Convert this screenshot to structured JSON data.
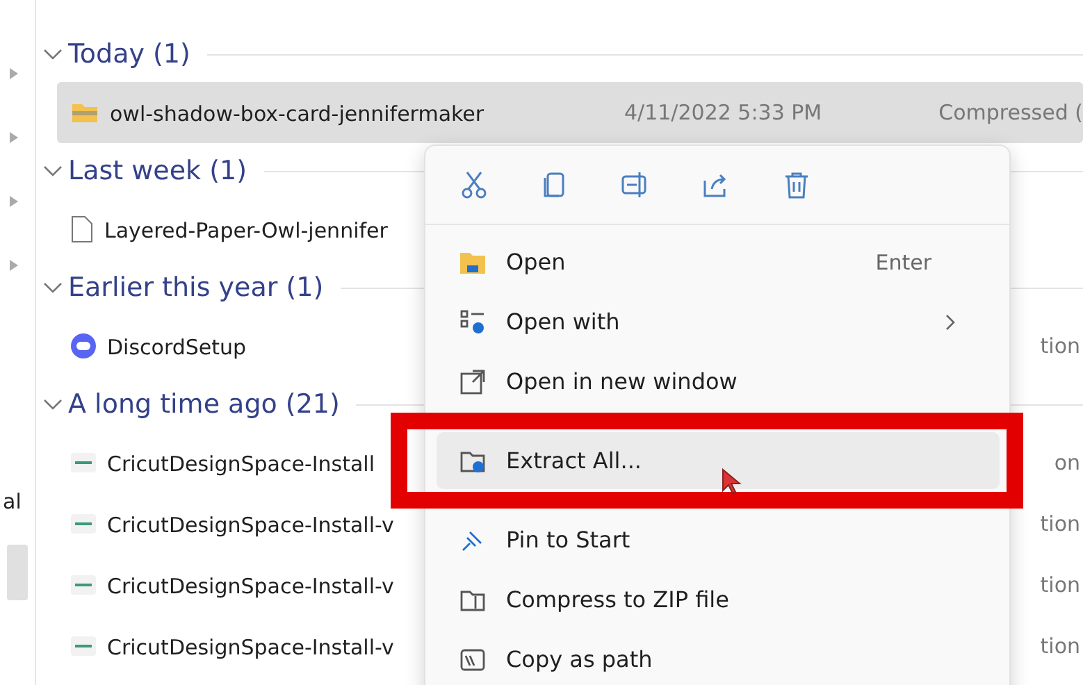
{
  "nav_pane": {
    "items": [
      {
        "label": "al"
      }
    ]
  },
  "groups": [
    {
      "title": "Today (1)",
      "expanded": true,
      "files": [
        {
          "name": "owl-shadow-box-card-jennifermaker",
          "kind": "zip",
          "date": "4/11/2022 5:33 PM",
          "type": "Compressed (",
          "selected": true
        }
      ]
    },
    {
      "title": "Last week (1)",
      "expanded": true,
      "files": [
        {
          "name": "Layered-Paper-Owl-jennifer",
          "kind": "document",
          "selected": false
        }
      ]
    },
    {
      "title": "Earlier this year (1)",
      "expanded": true,
      "files": [
        {
          "name": "DiscordSetup",
          "kind": "app",
          "type": "tion",
          "selected": false
        }
      ]
    },
    {
      "title": "A long time ago (21)",
      "expanded": true,
      "files": [
        {
          "name": "CricutDesignSpace-Install",
          "kind": "installer",
          "type": "on",
          "selected": false
        },
        {
          "name": "CricutDesignSpace-Install-v",
          "kind": "installer",
          "type": "tion",
          "selected": false
        },
        {
          "name": "CricutDesignSpace-Install-v",
          "kind": "installer",
          "type": "tion",
          "selected": false
        },
        {
          "name": "CricutDesignSpace-Install-v",
          "kind": "installer",
          "type": "tion",
          "selected": false
        }
      ]
    }
  ],
  "context_menu": {
    "items": [
      {
        "label": "Open",
        "kind": "open",
        "shortcut": "Enter",
        "selected": false
      },
      {
        "label": "Open with",
        "kind": "open-with",
        "submenu": true,
        "selected": false
      },
      {
        "label": "Open in new window",
        "kind": "new-window",
        "selected": false
      },
      {
        "label": "Extract All...",
        "kind": "extract",
        "selected": true,
        "outlined": true
      },
      {
        "label": "Pin to Start",
        "kind": "pin",
        "selected": false
      },
      {
        "label": "Compress to ZIP file",
        "kind": "compress",
        "selected": false
      },
      {
        "label": "Copy as path",
        "kind": "path",
        "selected": false
      }
    ]
  }
}
